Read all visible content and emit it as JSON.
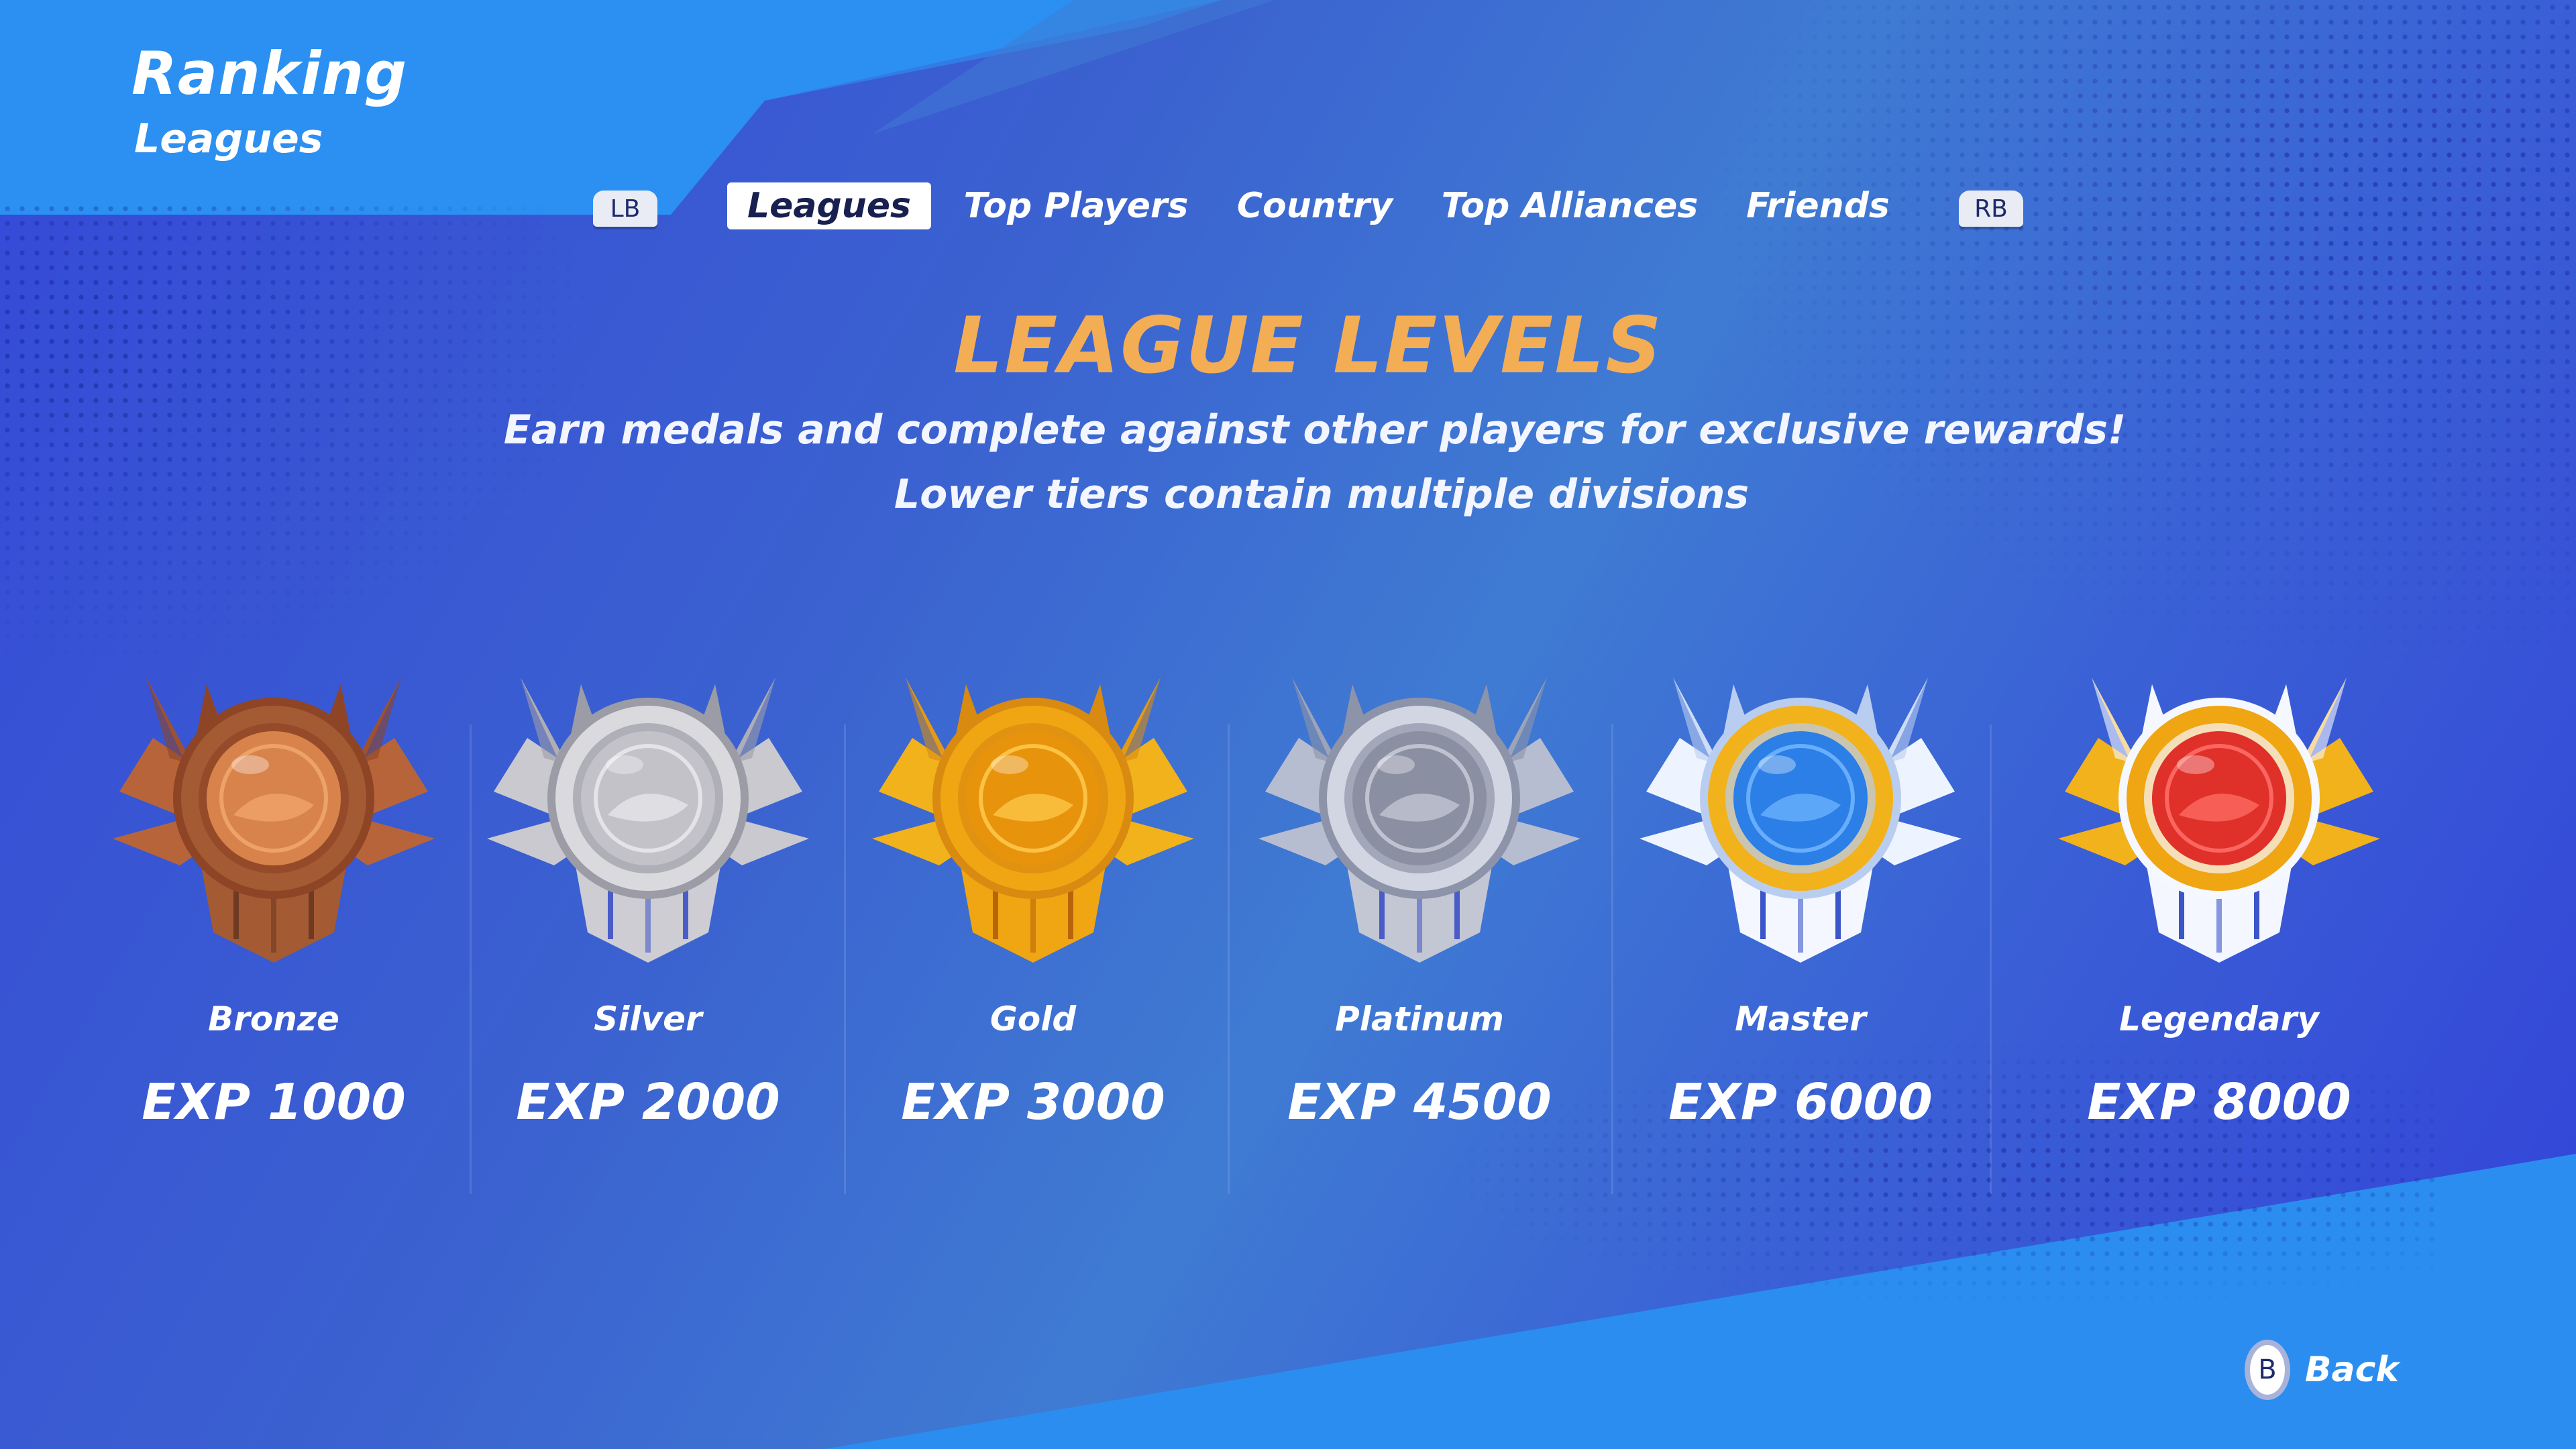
{
  "header": {
    "title": "Ranking",
    "subtitle": "Leagues"
  },
  "tabs": {
    "left_bumper": "LB",
    "right_bumper": "RB",
    "items": [
      {
        "label": "Leagues",
        "active": true
      },
      {
        "label": "Top Players",
        "active": false
      },
      {
        "label": "Country",
        "active": false
      },
      {
        "label": "Top Alliances",
        "active": false
      },
      {
        "label": "Friends",
        "active": false
      }
    ]
  },
  "main": {
    "heading": "LEAGUE LEVELS",
    "description_line1": "Earn medals and complete against other players for exclusive rewards!",
    "description_line2": "Lower tiers contain multiple divisions"
  },
  "leagues": [
    {
      "name": "Bronze",
      "exp": "EXP 1000",
      "icon": "bronze-medal-icon",
      "colors": {
        "wing": "#b8643a",
        "wing_dark": "#8e4526",
        "ring": "#a45a33",
        "gem": "#d9834c",
        "gem_light": "#f0a66c",
        "shield": "#a45a33",
        "stripe": "#6e3a22"
      }
    },
    {
      "name": "Silver",
      "exp": "EXP 2000",
      "icon": "silver-medal-icon",
      "colors": {
        "wing": "#c9c9cf",
        "wing_dark": "#9c9ca6",
        "ring": "#d9d9de",
        "gem": "#c2c2c8",
        "gem_light": "#e7e7ec",
        "shield": "#cdcdd3",
        "stripe": "#4a5cc8"
      }
    },
    {
      "name": "Gold",
      "exp": "EXP 3000",
      "icon": "gold-medal-icon",
      "colors": {
        "wing": "#f2b21c",
        "wing_dark": "#d98a10",
        "ring": "#f0a512",
        "gem": "#e8930c",
        "gem_light": "#ffc84a",
        "shield": "#f0a512",
        "stripe": "#b8650a"
      }
    },
    {
      "name": "Platinum",
      "exp": "EXP 4500",
      "icon": "platinum-medal-icon",
      "colors": {
        "wing": "#b7bdd0",
        "wing_dark": "#8d93a8",
        "ring": "#d2d6e2",
        "gem": "#8a8fa2",
        "gem_light": "#c5c9d6",
        "shield": "#c3c7d4",
        "stripe": "#4a5cc8"
      }
    },
    {
      "name": "Master",
      "exp": "EXP 6000",
      "icon": "master-medal-icon",
      "colors": {
        "wing": "#eef4ff",
        "wing_dark": "#b9cdf0",
        "ring": "#f2b21c",
        "gem": "#2b7fe6",
        "gem_light": "#6fb4ff",
        "shield": "#f4f7ff",
        "stripe": "#3a56c8"
      }
    },
    {
      "name": "Legendary",
      "exp": "EXP 8000",
      "icon": "legendary-medal-icon",
      "colors": {
        "wing": "#f2b21c",
        "wing_dark": "#f6f8ff",
        "ring": "#f0a512",
        "gem": "#e0302a",
        "gem_light": "#ff6e66",
        "shield": "#f4f7ff",
        "stripe": "#3a56c8"
      }
    }
  ],
  "footer": {
    "back_key": "B",
    "back_label": "Back"
  },
  "colors": {
    "accent": "#f3ad55",
    "background": "#3b62d0",
    "highlight": "#2b8df0"
  }
}
